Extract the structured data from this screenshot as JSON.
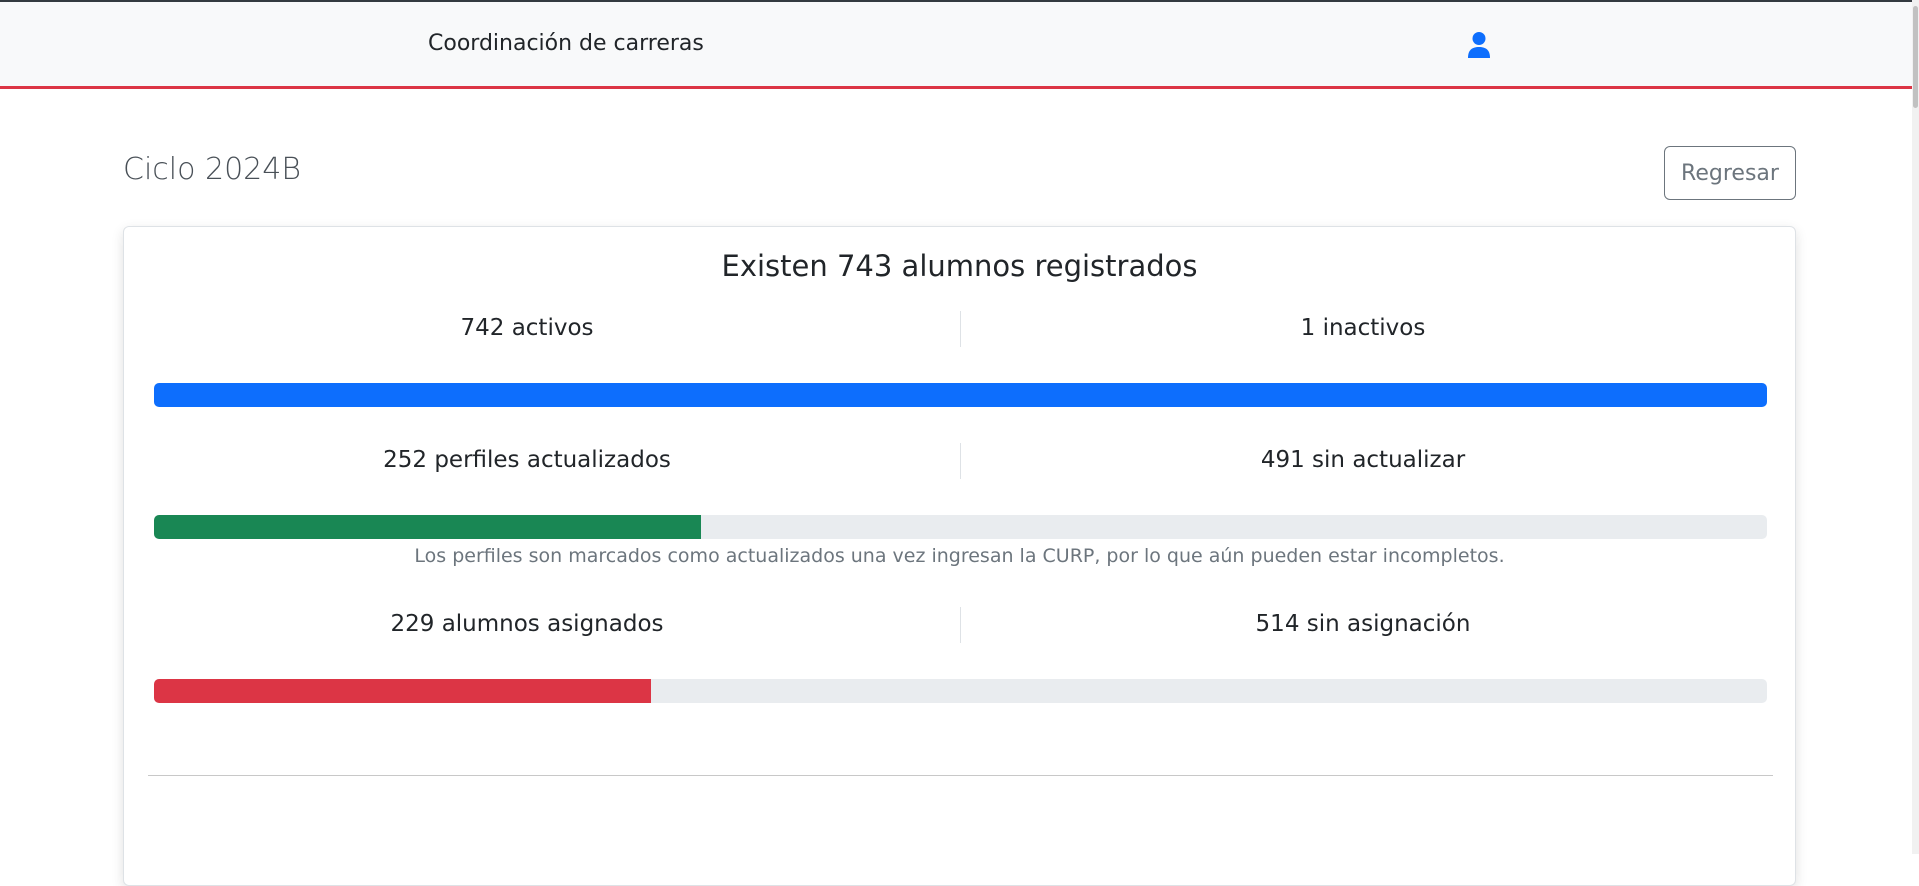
{
  "navbar": {
    "title": "Coordinación de carreras",
    "user_icon": "user-icon",
    "accent_color": "#dc3545"
  },
  "page": {
    "title": "Ciclo 2024B",
    "back_label": "Regresar"
  },
  "summary": {
    "heading": "Existen 743 alumnos registrados",
    "rows": [
      {
        "left": "742 activos",
        "right": "1 inactivos",
        "fraction": 1.0,
        "color": "#0d6efd"
      },
      {
        "left": "252 perfiles actualizados",
        "right": "491 sin actualizar",
        "fraction": 0.339,
        "color": "#198754"
      },
      {
        "left": "229 alumnos asignados",
        "right": "514 sin asignación",
        "fraction": 0.308,
        "color": "#dc3545"
      }
    ],
    "note": "Los perfiles son marcados como actualizados una vez ingresan la CURP, por lo que aún pueden estar incompletos."
  }
}
